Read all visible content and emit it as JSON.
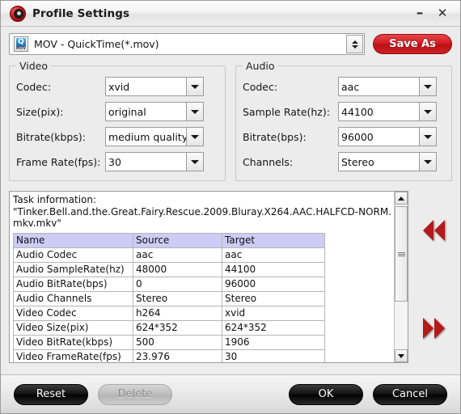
{
  "window": {
    "title": "Profile Settings",
    "app_icon": "disc-icon",
    "minimize_label": "–",
    "close_label": "✕"
  },
  "profile": {
    "icon": "mov-file-icon",
    "icon_badge": "MOV",
    "icon_letter": "Q",
    "selected": "MOV - QuickTime(*.mov)",
    "spinner": "spinner-up-down",
    "save_as_label": "Save As"
  },
  "video": {
    "legend": "Video",
    "fields": [
      {
        "label": "Codec:",
        "value": "xvid"
      },
      {
        "label": "Size(pix):",
        "value": "original"
      },
      {
        "label": "Bitrate(kbps):",
        "value": "medium quality"
      },
      {
        "label": "Frame Rate(fps):",
        "value": "30"
      }
    ]
  },
  "audio": {
    "legend": "Audio",
    "fields": [
      {
        "label": "Codec:",
        "value": "aac"
      },
      {
        "label": "Sample Rate(hz):",
        "value": "44100"
      },
      {
        "label": "Bitrate(bps):",
        "value": "96000"
      },
      {
        "label": "Channels:",
        "value": "Stereo"
      }
    ]
  },
  "task": {
    "title": "Task information:",
    "filename": "\"Tinker.Bell.and.the.Great.Fairy.Rescue.2009.Bluray.X264.AAC.HALFCD-NORM.mkv.mkv\"",
    "columns": [
      "Name",
      "Source",
      "Target"
    ],
    "rows": [
      [
        "Audio Codec",
        "aac",
        "aac"
      ],
      [
        "Audio SampleRate(hz)",
        "48000",
        "44100"
      ],
      [
        "Audio BitRate(bps)",
        "0",
        "96000"
      ],
      [
        "Audio Channels",
        "Stereo",
        "Stereo"
      ],
      [
        "Video Codec",
        "h264",
        "xvid"
      ],
      [
        "Video Size(pix)",
        "624*352",
        "624*352"
      ],
      [
        "Video BitRate(kbps)",
        "500",
        "1906"
      ],
      [
        "Video FrameRate(fps)",
        "23.976",
        "30"
      ]
    ]
  },
  "nav": {
    "prev_icon": "rewind-double-left-icon",
    "next_icon": "forward-double-right-icon"
  },
  "footer": {
    "reset_label": "Reset",
    "delete_label": "Delete",
    "ok_label": "OK",
    "cancel_label": "Cancel"
  },
  "colors": {
    "accent_red": "#d31a1f",
    "table_header": "#ccccf5",
    "window_bg": "#ececec",
    "nav_arrow": "#b51a1a"
  }
}
